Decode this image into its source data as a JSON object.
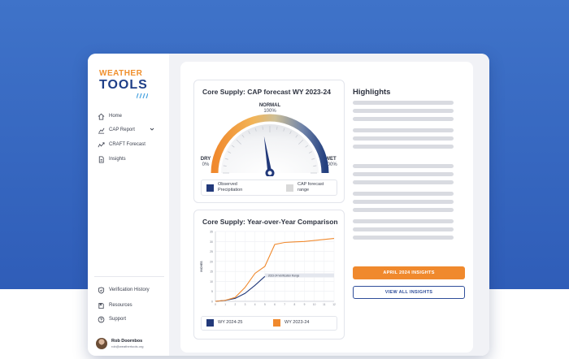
{
  "logo": {
    "word_top": "WEATHER",
    "word_bottom": "TOOLS"
  },
  "sidebar": {
    "items": [
      {
        "label": "Home",
        "icon": "home-icon"
      },
      {
        "label": "CAP Report",
        "icon": "chart-icon"
      },
      {
        "label": "CRAFT Forecast",
        "icon": "forecast-icon"
      },
      {
        "label": "Insights",
        "icon": "document-icon"
      }
    ],
    "bottom_items": [
      {
        "label": "Verification History",
        "icon": "shield-check-icon"
      },
      {
        "label": "Resources",
        "icon": "resources-icon"
      },
      {
        "label": "Support",
        "icon": "help-icon"
      }
    ],
    "user": {
      "name": "Rob Doornbos",
      "email": "rob@weathertools.org"
    }
  },
  "gauge_card": {
    "title": "Core Supply: CAP forecast WY 2023-24",
    "top_label": "NORMAL",
    "top_value": "100%",
    "left_label": "DRY",
    "left_value": "0%",
    "right_label": "WET",
    "right_value": "200%",
    "needle_value_percent": 90,
    "legend": [
      {
        "label": "Observed Precipitation",
        "color": "#22397a"
      },
      {
        "label": "CAP forecast range",
        "color": "#d9d9d9"
      }
    ]
  },
  "yoy_card": {
    "title": "Core Supply: Year-over-Year Comparison",
    "legend": [
      {
        "label": "WY 2024-25",
        "color": "#22397a"
      },
      {
        "label": "WY 2023-24",
        "color": "#f0892d"
      }
    ]
  },
  "chart_data": {
    "type": "line",
    "title": "Core Supply: Year-over-Year Comparison",
    "xlabel": "",
    "ylabel": "INCHES",
    "x": [
      0,
      1,
      2,
      3,
      4,
      5,
      6,
      7,
      8,
      9,
      10,
      11,
      12
    ],
    "ylim": [
      0,
      35
    ],
    "yticks": [
      0,
      5,
      10,
      15,
      20,
      25,
      30,
      35
    ],
    "annotation": {
      "text": "2023-24 Verification Range",
      "x_start": 5,
      "x_end": 12,
      "y_low": 12,
      "y_high": 14
    },
    "series": [
      {
        "name": "WY 2024-25",
        "color": "#22397a",
        "values": [
          0,
          0.5,
          1.5,
          4,
          8,
          12.5,
          null,
          null,
          null,
          null,
          null,
          null,
          null
        ]
      },
      {
        "name": "WY 2023-24",
        "color": "#f0892d",
        "values": [
          0,
          0.5,
          2,
          7,
          14,
          17.5,
          28.5,
          29.5,
          29.8,
          30,
          30.5,
          31,
          31.5
        ]
      }
    ],
    "grid": true,
    "legend_position": "bottom"
  },
  "highlights": {
    "title": "Highlights",
    "primary_button": "APRIL 2024 INSIGHTS",
    "secondary_button": "VIEW ALL INSIGHTS"
  }
}
